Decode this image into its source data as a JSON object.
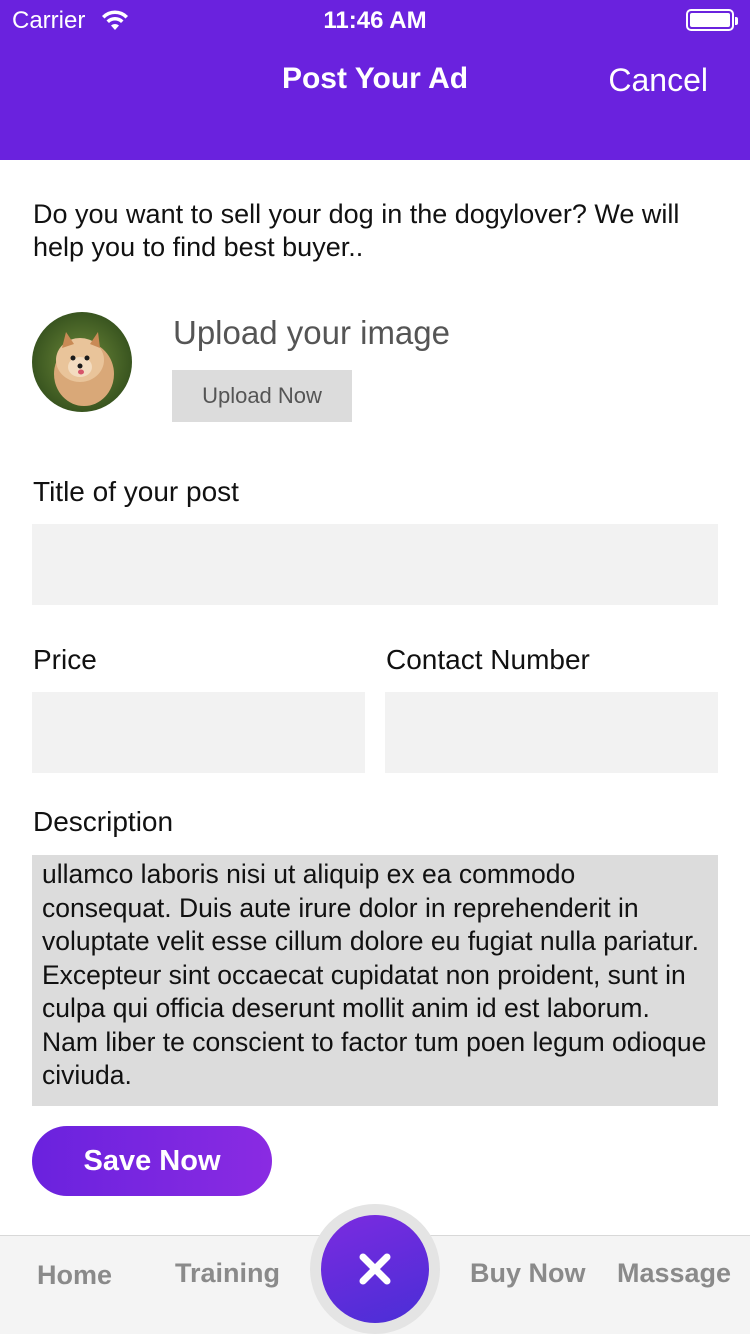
{
  "status_bar": {
    "carrier": "Carrier",
    "time": "11:46 AM"
  },
  "nav": {
    "title": "Post Your Ad",
    "cancel_label": "Cancel"
  },
  "intro_text": "Do you want to sell your dog in the dogylover? We will help you to find best buyer..",
  "upload": {
    "title": "Upload your image",
    "button_label": "Upload Now"
  },
  "form": {
    "title_label": "Title of your post",
    "title_value": "",
    "price_label": "Price",
    "price_value": "",
    "contact_label": "Contact Number",
    "contact_value": "",
    "description_label": "Description",
    "description_value": "ullamco laboris nisi ut aliquip ex ea commodo consequat. Duis aute irure dolor in reprehenderit in voluptate velit esse cillum dolore eu fugiat nulla pariatur. Excepteur sint occaecat cupidatat non proident, sunt in culpa qui officia deserunt mollit anim id est laborum. Nam liber te conscient to factor tum poen legum odioque civiuda."
  },
  "save_label": "Save Now",
  "tabbar": {
    "home": "Home",
    "training": "Training",
    "buy_now": "Buy Now",
    "massage": "Massage",
    "center_icon": "close-icon"
  },
  "colors": {
    "header": "#6a22de",
    "accent": "#8a2be2",
    "field_bg": "#f2f2f2",
    "description_bg": "#dcdcdc"
  }
}
